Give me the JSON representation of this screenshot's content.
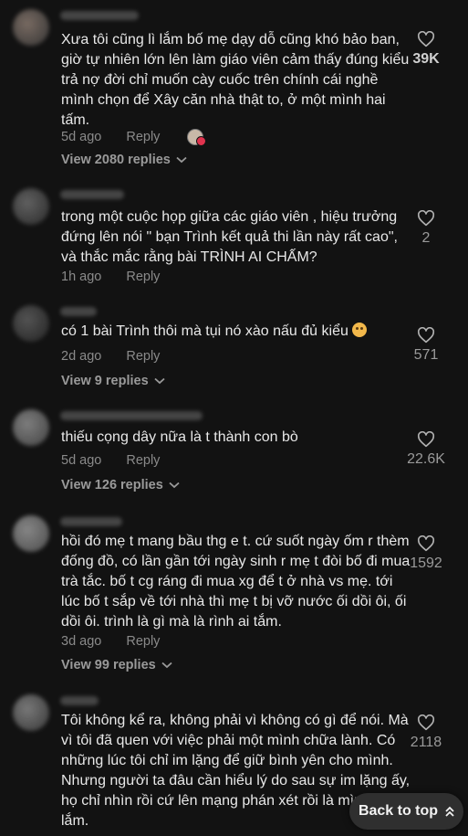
{
  "comments": [
    {
      "text": "Xưa tôi cũng lì lắm bố mẹ dạy dỗ cũng khó bảo ban, giờ tự nhiên lớn lên làm giáo viên cảm thấy đúng kiểu trả nợ đời chỉ muốn cày cuốc trên chính cái nghề mình chọn để Xây căn nhà thật to, ở một mình hai tấm.",
      "age": "5d ago",
      "reply": "Reply",
      "likes": "39K",
      "view_replies": "View 2080 replies"
    },
    {
      "text": "trong một cuộc họp giữa các giáo viên , hiệu trưởng đứng lên nói \" bạn Trình kết quả thi lần này rất cao\", và thắc mắc rằng bài TRÌNH AI CHẤM?",
      "age": "1h ago",
      "reply": "Reply",
      "likes": "2"
    },
    {
      "text": "có 1 bài Trình thôi mà tụi nó xào nấu đủ kiểu",
      "age": "2d ago",
      "reply": "Reply",
      "likes": "571",
      "view_replies": "View 9 replies"
    },
    {
      "text": "thiếu cọng dây nữa là t thành con bò",
      "age": "5d ago",
      "reply": "Reply",
      "likes": "22.6K",
      "view_replies": "View 126 replies"
    },
    {
      "text": "hồi đó mẹ t mang bầu thg e t. cứ suốt ngày ốm r thèm đống đồ, có lần gần tới ngày sinh r mẹ t đòi bố đi mua trà tắc. bố t cg ráng đi mua xg để t ở nhà vs mẹ. tới lúc bố t sắp về tới nhà thì mẹ t bị vỡ nước ối dồi ôi, ối dồi ôi. trình là gì mà là rình ai tắm.",
      "age": "3d ago",
      "reply": "Reply",
      "likes": "1592",
      "view_replies": "View 99 replies"
    },
    {
      "text": "Tôi không kể ra, không phải vì không có gì để nói. Mà vì tôi đã quen với việc phải một mình chữa lành. Có những lúc tôi chỉ im lặng để giữ bình yên cho mình. Nhưng người ta đâu cần hiểu lý do sau sự im lặng ấy, họ chỉ nhìn rồi cứ lên mạng phán xét rồi là mình oai lắm.",
      "likes": "2118"
    }
  ],
  "back_to_top": "Back to top",
  "colors": {
    "background": "#121212",
    "text": "#e8e8e8",
    "muted": "#8a8a8a"
  },
  "icons": [
    "heart-outline-icon",
    "chevron-down-icon",
    "double-chevron-up-icon"
  ]
}
